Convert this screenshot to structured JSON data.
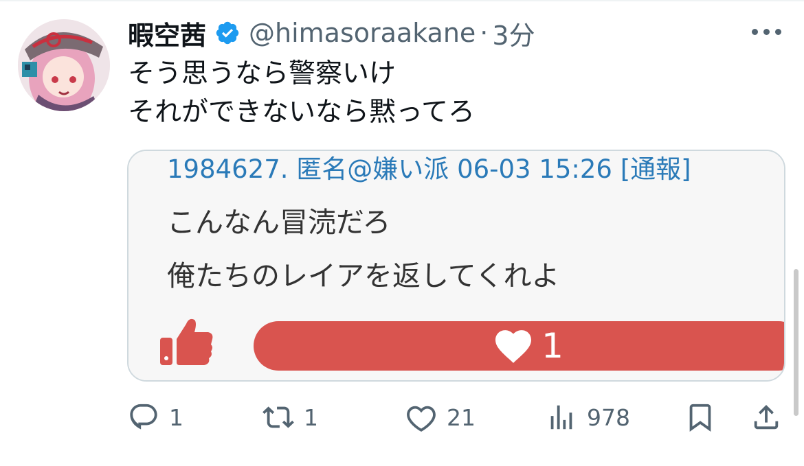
{
  "tweet": {
    "display_name": "暇空茜",
    "handle": "@himasoraakane",
    "separator": "·",
    "time": "3分",
    "text_lines": [
      "そう思うなら警察いけ",
      "それができないなら黙ってろ"
    ]
  },
  "media": {
    "post_header": "1984627. 匿名@嫌い派 06-03 15:26 [通報]",
    "post_lines": [
      "こんなん冒涜だろ",
      "俺たちのレイアを返してくれよ"
    ],
    "like_count": "1"
  },
  "actions": {
    "replies": "1",
    "retweets": "1",
    "likes": "21",
    "views": "978"
  },
  "colors": {
    "verified": "#1d9bf0",
    "like_bar": "#d9544f",
    "post_header": "#2a7ab8",
    "secondary_text": "#536471"
  },
  "icons": [
    "verified-icon",
    "more-icon",
    "thumbs-up-icon",
    "heart-icon",
    "reply-icon",
    "retweet-icon",
    "like-icon",
    "views-icon",
    "bookmark-icon",
    "share-icon"
  ]
}
